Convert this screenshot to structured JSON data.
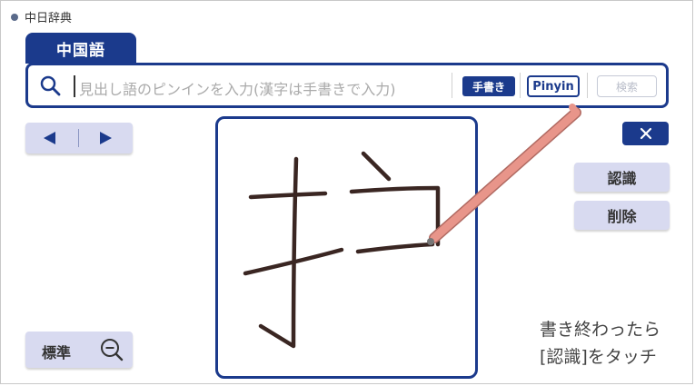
{
  "app": {
    "title": "中日辞典"
  },
  "tabs": [
    {
      "label": "中国語",
      "active": true
    }
  ],
  "search": {
    "value": "",
    "placeholder": "見出し語のピンインを入力(漢字は手書きで入力)",
    "handwriting_label": "手書き",
    "pinyin_label": "Pinyin",
    "search_label": "検索"
  },
  "nav": {
    "prev_icon": "triangle-left-icon",
    "next_icon": "triangle-right-icon"
  },
  "controls": {
    "close_icon": "close-icon",
    "recognize_label": "認識",
    "delete_label": "削除",
    "standard_label": "標準",
    "zoom_icon": "zoom-out-icon"
  },
  "hint": {
    "line1": "書き終わったら",
    "line2": "[認識]をタッチ"
  },
  "colors": {
    "accent": "#1b3a8c",
    "button_bg": "#d8daf0",
    "stroke": "#3a2622",
    "stylus": "#e8958a"
  }
}
